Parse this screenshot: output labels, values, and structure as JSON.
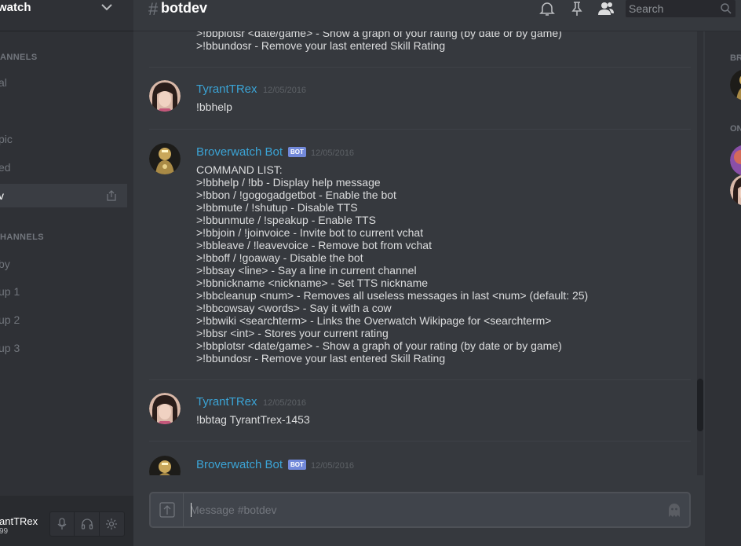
{
  "server": {
    "name": "watch"
  },
  "sidebar": {
    "categories": [
      "ANNELS",
      "HANNELS"
    ],
    "text_channels": [
      {
        "label": "al"
      },
      {
        "label": "pic"
      },
      {
        "label": "ed"
      },
      {
        "label": "v"
      }
    ],
    "voice_channels": [
      {
        "label": "by"
      },
      {
        "label": "up 1"
      },
      {
        "label": "up 2"
      },
      {
        "label": "up 3"
      }
    ]
  },
  "user_panel": {
    "name": "antTRex",
    "discriminator": "99"
  },
  "header": {
    "hash": "#",
    "channel": "botdev",
    "search_placeholder": "Search"
  },
  "messages": {
    "top_partial_lines": [
      ">!bbplotsr  <date/game>    -    Show a graph of your rating (by date or by game)",
      ">!bbundosr    -    Remove your last entered Skill Rating"
    ],
    "groups": [
      {
        "author": "TyrantTRex",
        "timestamp": "12/05/2016",
        "lines": [
          "!bbhelp"
        ]
      },
      {
        "author": "Broverwatch Bot",
        "bot_tag": "BOT",
        "timestamp": "12/05/2016",
        "lines": [
          "COMMAND LIST:",
          ">!bbhelp / !bb    -    Display help message",
          ">!bbon / !gogogadgetbot    -    Enable the bot",
          ">!bbmute / !shutup    -    Disable TTS",
          ">!bbunmute / !speakup    -    Enable TTS",
          ">!bbjoin / !joinvoice    -    Invite bot to current vchat",
          ">!bbleave / !leavevoice    -    Remove bot from vchat",
          ">!bboff / !goaway    -    Disable the bot",
          ">!bbsay <line>    -    Say a line in current channel",
          ">!bbnickname <nickname>    -    Set TTS nickname",
          ">!bbcleanup <num>    -    Removes all useless messages in last <num> (default: 25)",
          ">!bbcowsay <words>    -    Say it with a cow",
          ">!bbwiki <searchterm>    -    Links the Overwatch Wikipage for <searchterm>",
          ">!bbsr <int>    -    Stores your current rating",
          ">!bbplotsr  <date/game>    -    Show a graph of your rating (by date or by game)",
          ">!bbundosr    -    Remove your last entered Skill Rating"
        ]
      },
      {
        "author": "TyrantTRex",
        "timestamp": "12/05/2016",
        "lines": [
          "!bbtag TyrantTrex-1453"
        ]
      },
      {
        "author": "Broverwatch Bot",
        "bot_tag": "BOT",
        "timestamp": "12/05/2016",
        "lines": []
      }
    ]
  },
  "composer": {
    "placeholder": "Message #botdev"
  },
  "members": {
    "categories": [
      "BR",
      "ON"
    ]
  },
  "colors": {
    "background": "#36393e",
    "sidebar": "#2f3136",
    "author": "#3ba4d6",
    "bot_tag": "#7289da"
  },
  "icons": [
    "chevron-down-icon",
    "invite-icon",
    "bell-icon",
    "pin-icon",
    "members-icon",
    "search-icon",
    "microphone-icon",
    "headphones-icon",
    "gear-icon",
    "upload-icon",
    "emoji-icon"
  ]
}
